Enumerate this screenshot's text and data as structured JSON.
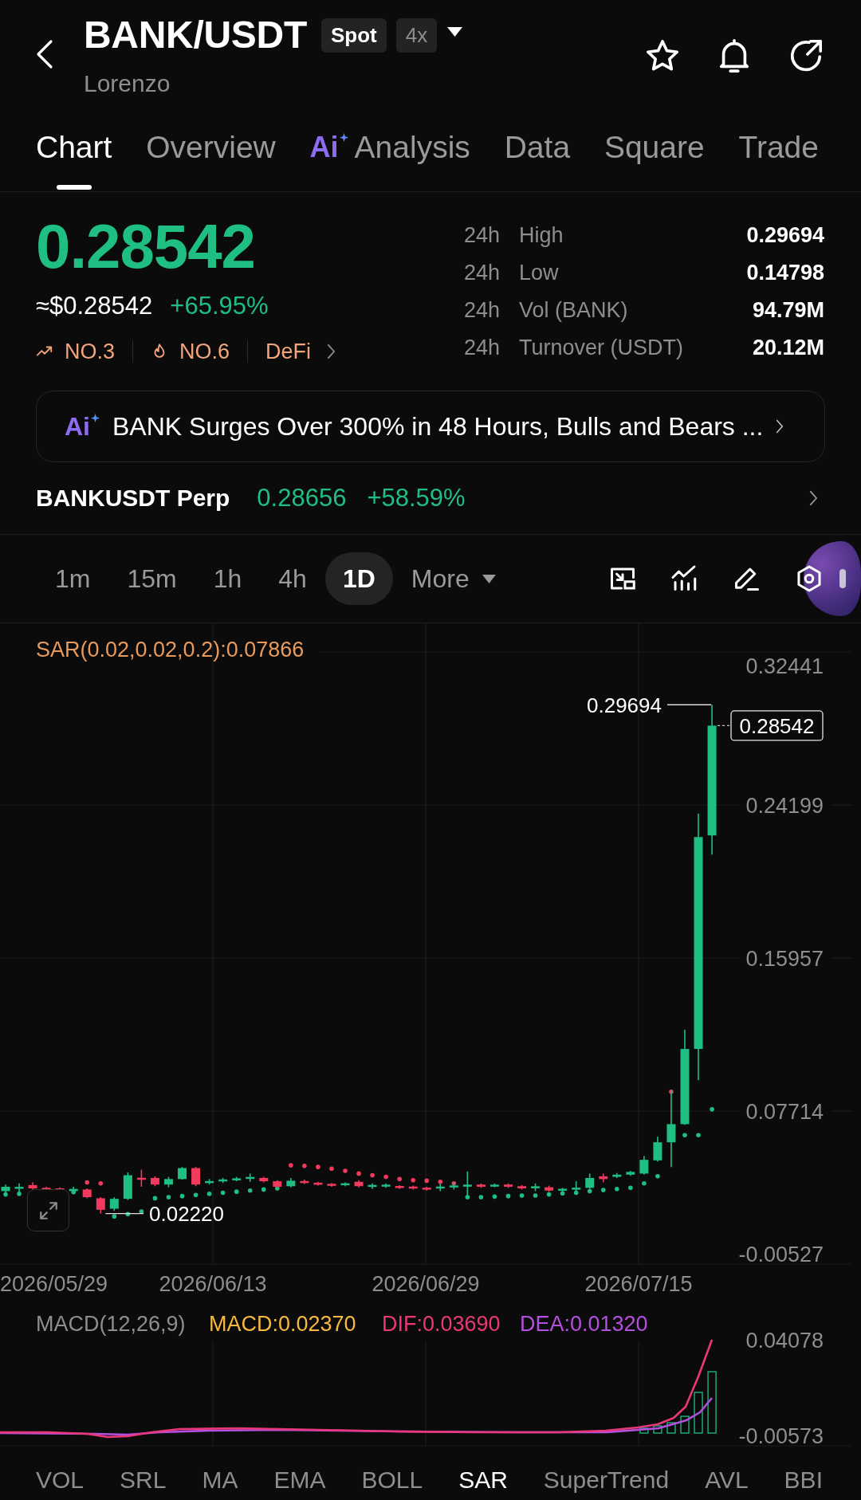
{
  "header": {
    "pair": "BANK/USDT",
    "market_type": "Spot",
    "leverage": "4x",
    "project": "Lorenzo"
  },
  "tabs": [
    {
      "label": "Chart",
      "selected": true,
      "kind": "plain"
    },
    {
      "label": "Overview",
      "selected": false,
      "kind": "plain"
    },
    {
      "label": "Analysis",
      "selected": false,
      "kind": "ai",
      "badge": "Ai"
    },
    {
      "label": "Data",
      "selected": false,
      "kind": "plain"
    },
    {
      "label": "Square",
      "selected": false,
      "kind": "plain"
    },
    {
      "label": "Trade",
      "selected": false,
      "kind": "plain"
    }
  ],
  "price": {
    "last": "0.28542",
    "rising": true,
    "usd": "≈$0.28542",
    "change": "+65.95%"
  },
  "tags": [
    {
      "kind": "trending",
      "label": "NO.3"
    },
    {
      "kind": "hot",
      "label": "NO.6"
    },
    {
      "kind": "sector",
      "label": "DeFi"
    }
  ],
  "stats": [
    {
      "period": "24h",
      "label": "High",
      "value": "0.29694"
    },
    {
      "period": "24h",
      "label": "Low",
      "value": "0.14798"
    },
    {
      "period": "24h",
      "label": "Vol (BANK)",
      "value": "94.79M"
    },
    {
      "period": "24h",
      "label": "Turnover (USDT)",
      "value": "20.12M"
    }
  ],
  "news": {
    "badge": "Ai",
    "headline": "BANK Surges Over 300% in 48 Hours, Bulls and Bears ..."
  },
  "perp": {
    "name": "BANKUSDT Perp",
    "price": "0.28656",
    "change": "+58.59%",
    "rising": true
  },
  "intervals": [
    {
      "label": "1m",
      "selected": false,
      "kind": "interval"
    },
    {
      "label": "15m",
      "selected": false,
      "kind": "interval"
    },
    {
      "label": "1h",
      "selected": false,
      "kind": "interval"
    },
    {
      "label": "4h",
      "selected": false,
      "kind": "interval"
    },
    {
      "label": "1D",
      "selected": true,
      "kind": "interval"
    },
    {
      "label": "More",
      "selected": false,
      "kind": "menu"
    }
  ],
  "chart": {
    "legend": "SAR(0.02,0.02,0.2):0.07866",
    "price_axis": [
      "0.32441",
      "0.24199",
      "0.15957",
      "0.07714",
      "-0.00527"
    ],
    "high_label": "0.29694",
    "last_price": "0.28542",
    "low_label": "0.02220",
    "date_axis": [
      "2026/05/29",
      "2026/06/13",
      "2026/06/29",
      "2026/07/15"
    ]
  },
  "macd": {
    "legend": [
      {
        "text": "MACD(12,26,9)",
        "color": "#8e8e8e"
      },
      {
        "text": "MACD:0.02370",
        "color": "#f7b93e"
      },
      {
        "text": "DIF:0.03690",
        "color": "#e9387a"
      },
      {
        "text": "DEA:0.01320",
        "color": "#b44fe0"
      }
    ],
    "axis": [
      "0.04078",
      "-0.00573"
    ]
  },
  "indicators": [
    {
      "label": "VOL",
      "selected": false
    },
    {
      "label": "SRL",
      "selected": false
    },
    {
      "label": "MA",
      "selected": false
    },
    {
      "label": "EMA",
      "selected": false
    },
    {
      "label": "BOLL",
      "selected": false
    },
    {
      "label": "SAR",
      "selected": true
    },
    {
      "label": "SuperTrend",
      "selected": false
    },
    {
      "label": "AVL",
      "selected": false
    },
    {
      "label": "BBI",
      "selected": false
    }
  ]
}
